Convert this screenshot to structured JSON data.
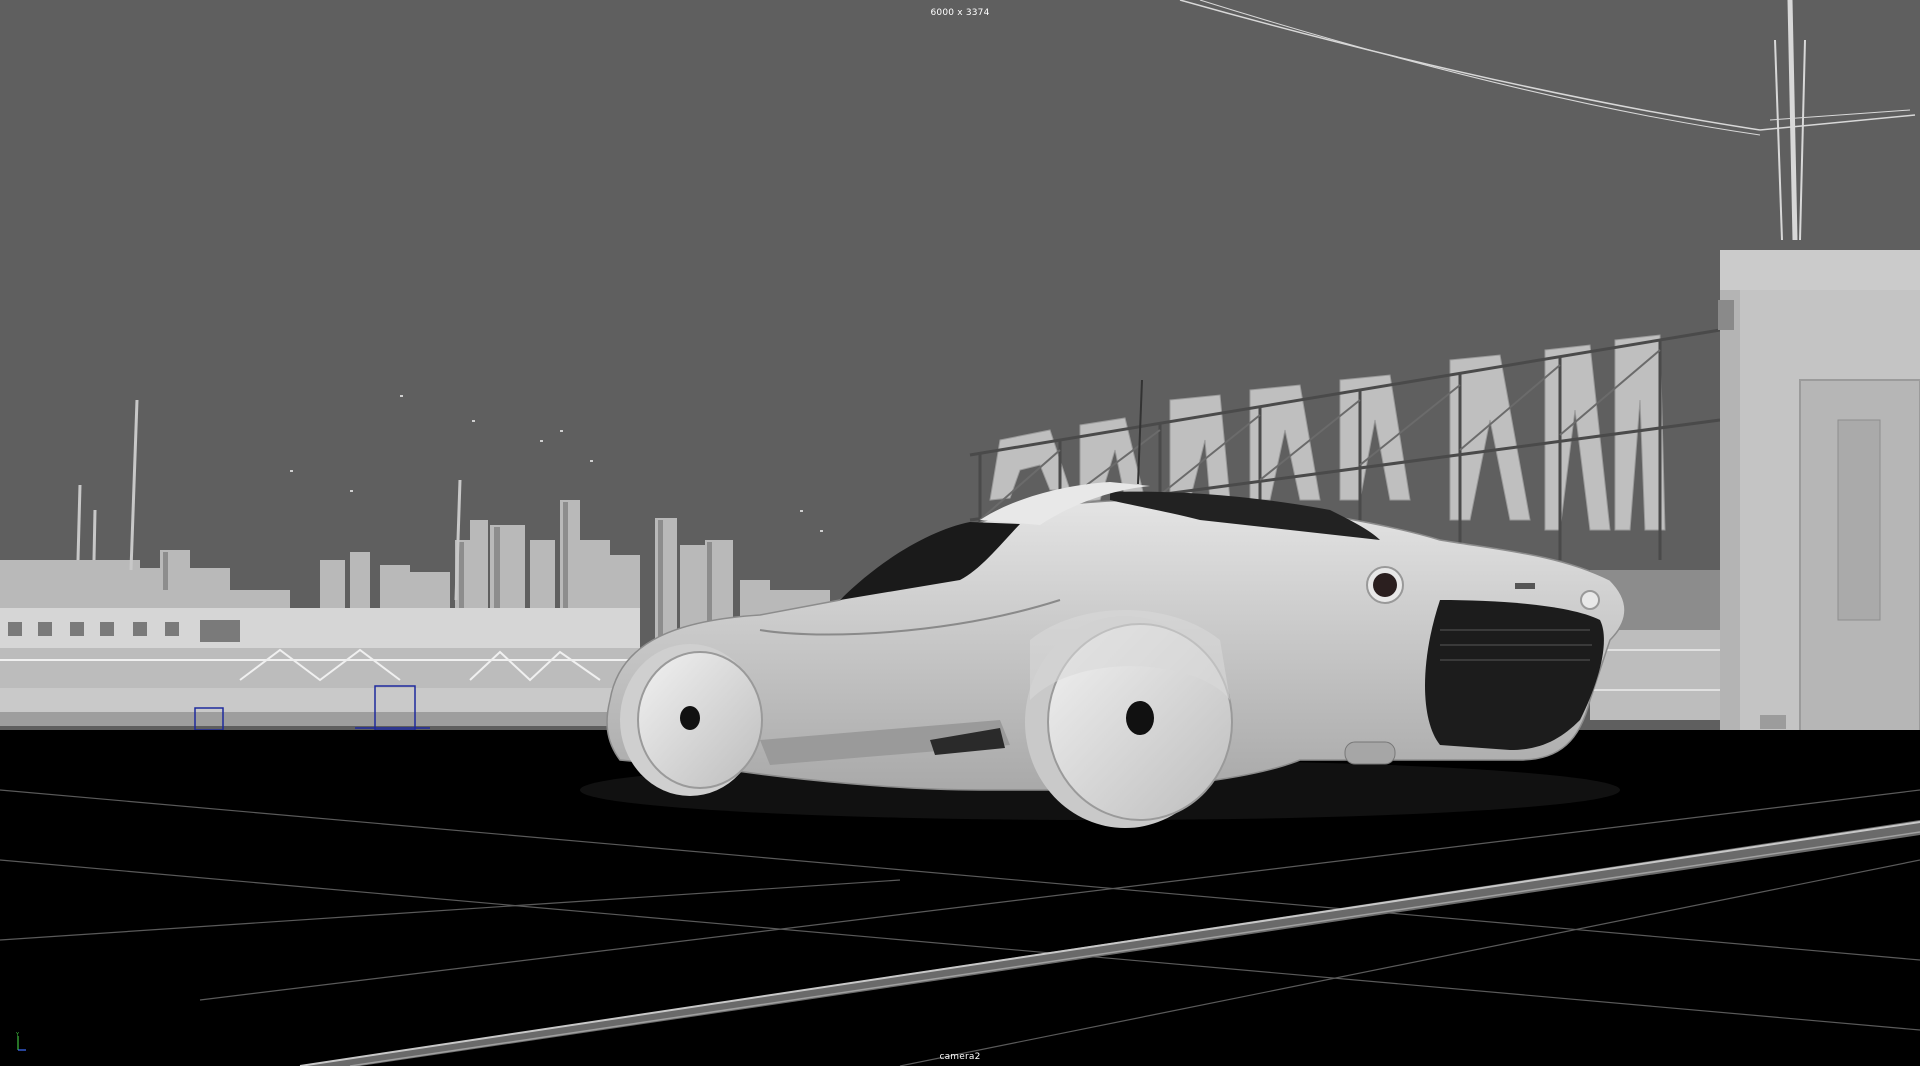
{
  "viewport": {
    "resolution_gate_label": "6000 x 3374",
    "camera_name": "camera2"
  },
  "colors": {
    "sky": "#5f5f5f",
    "ground": "#000000",
    "geometry": "#c8c8c8",
    "wireframe_selection": "#1e2a9e"
  },
  "icons": {
    "axis_gizmo": "axis-gizmo-icon"
  }
}
